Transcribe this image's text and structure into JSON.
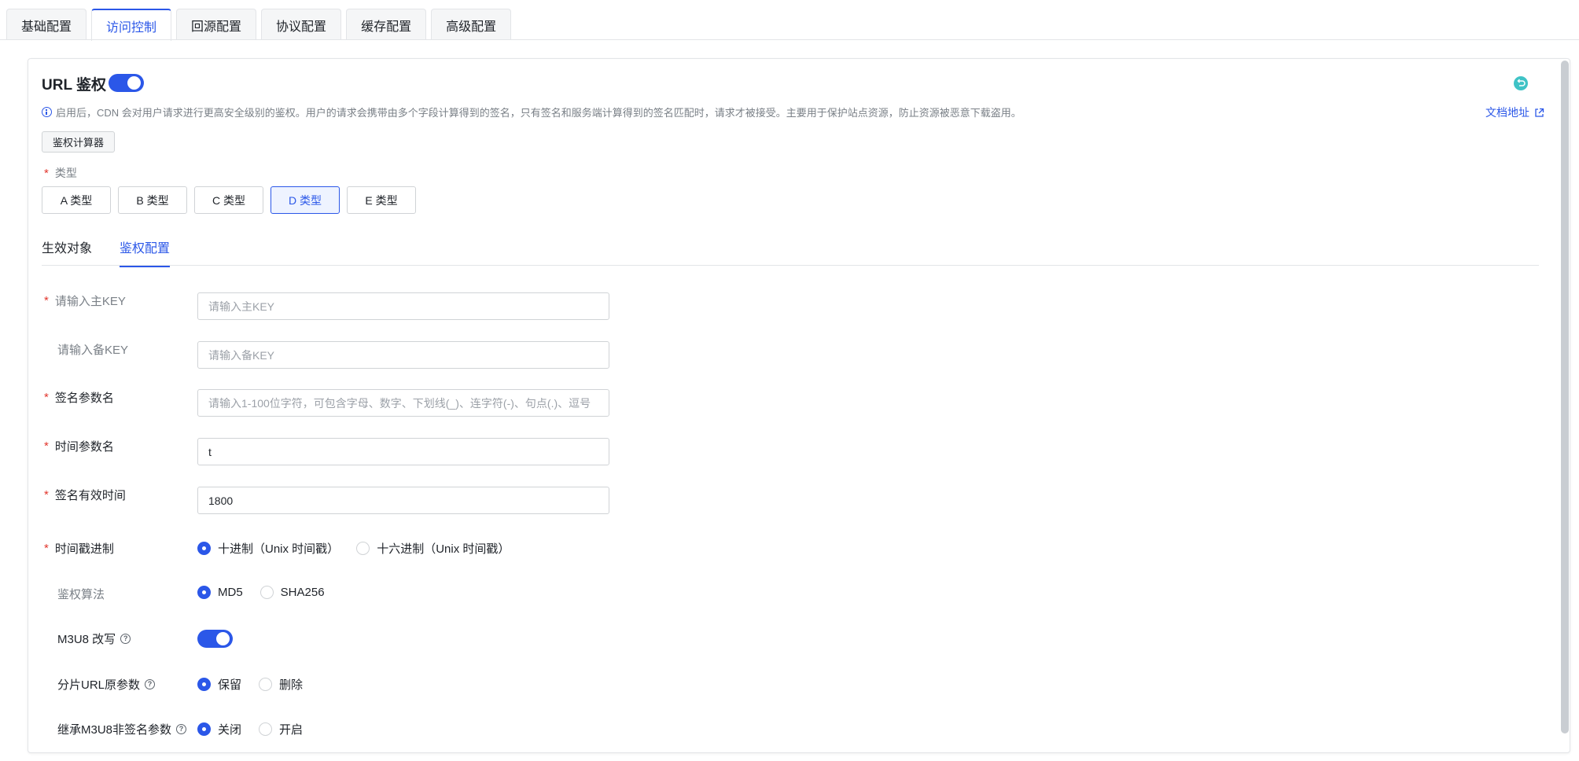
{
  "top_tabs": [
    {
      "label": "基础配置"
    },
    {
      "label": "访问控制"
    },
    {
      "label": "回源配置"
    },
    {
      "label": "协议配置"
    },
    {
      "label": "缓存配置"
    },
    {
      "label": "高级配置"
    }
  ],
  "active_top_tab": "访问控制",
  "section": {
    "title": "URL 鉴权",
    "enabled": true,
    "notice": "启用后，CDN 会对用户请求进行更高安全级别的鉴权。用户的请求会携带由多个字段计算得到的签名，只有签名和服务端计算得到的签名匹配时，请求才被接受。主要用于保护站点资源，防止资源被恶意下载盗用。",
    "doc_link": "文档地址",
    "calc_button": "鉴权计算器"
  },
  "type_field": {
    "label": "类型",
    "options": [
      "A 类型",
      "B 类型",
      "C 类型",
      "D 类型",
      "E 类型"
    ],
    "selected": "D 类型"
  },
  "sub_tabs": [
    {
      "label": "生效对象"
    },
    {
      "label": "鉴权配置"
    }
  ],
  "active_sub_tab": "鉴权配置",
  "form": {
    "primary_key": {
      "label": "请输入主KEY",
      "value": "",
      "placeholder": "请输入主KEY"
    },
    "backup_key": {
      "label": "请输入备KEY",
      "value": "",
      "placeholder": "请输入备KEY"
    },
    "sign_param": {
      "label": "签名参数名",
      "value": "",
      "placeholder": "请输入1-100位字符，可包含字母、数字、下划线(_)、连字符(-)、句点(.)、逗号"
    },
    "time_param": {
      "label": "时间参数名",
      "value": "t",
      "placeholder": ""
    },
    "sign_ttl": {
      "label": "签名有效时间",
      "value": "1800",
      "placeholder": ""
    },
    "timestamp_base": {
      "label": "时间戳进制",
      "options": [
        "十进制（Unix 时间戳）",
        "十六进制（Unix 时间戳）"
      ],
      "selected": 0
    },
    "algorithm": {
      "label": "鉴权算法",
      "options": [
        "MD5",
        "SHA256"
      ],
      "selected": 0
    },
    "m3u8_rewrite": {
      "label": "M3U8 改写",
      "enabled": true
    },
    "segment_url_params": {
      "label": "分片URL原参数",
      "options": [
        "保留",
        "删除"
      ],
      "selected": 0
    },
    "inherit_m3u8_params": {
      "label": "继承M3U8非签名参数",
      "options": [
        "关闭",
        "开启"
      ],
      "selected": 0
    }
  },
  "colors": {
    "accent": "#2b57e8",
    "required": "#e2362d",
    "reset_icon": "#3fc3c6"
  },
  "icons": [
    "info-icon",
    "external-link-icon",
    "reset-icon",
    "help-icon"
  ]
}
